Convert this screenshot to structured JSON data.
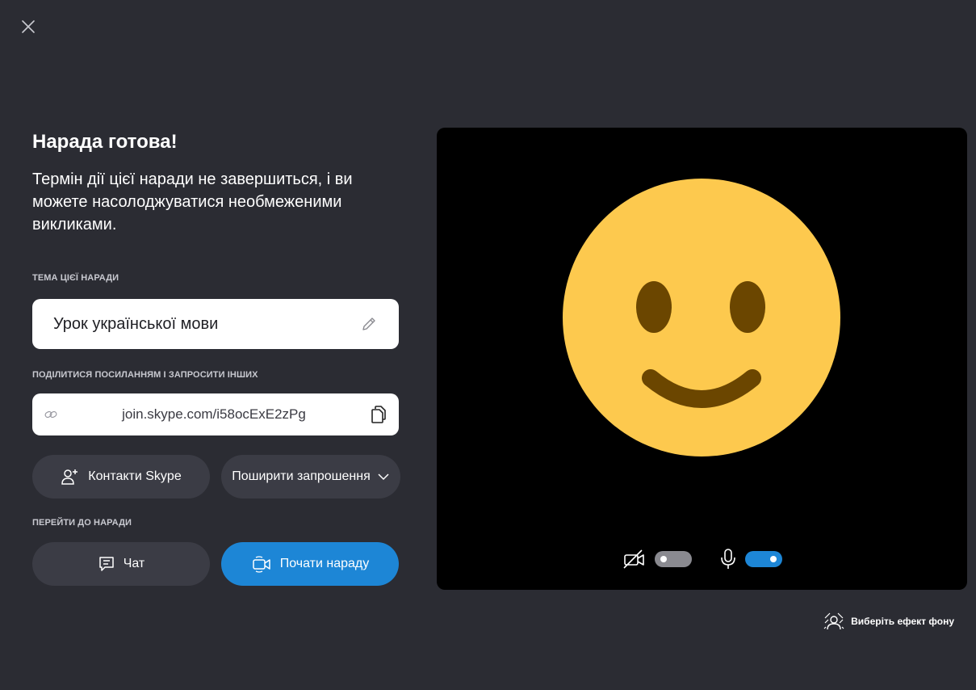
{
  "window": {
    "close_icon": "close-icon"
  },
  "meeting": {
    "title": "Нарада готова!",
    "description": "Термін дії цієї наради не завершиться, і ви можете насолоджуватися необмеженими викликами."
  },
  "topic": {
    "label": "ТЕМА ЦІЄЇ НАРАДИ",
    "value": "Урок української мови",
    "edit_icon": "pencil-icon"
  },
  "share": {
    "label": "ПОДІЛИТИСЯ ПОСИЛАННЯМ І ЗАПРОСИТИ ІНШИХ",
    "link": "join.skype.com/i58ocExE2zPg",
    "link_icon": "link-icon",
    "copy_icon": "copy-icon",
    "contacts_button": "Контакти Skype",
    "share_invite_button": "Поширити запрошення"
  },
  "go": {
    "label": "ПЕРЕЙТИ ДО НАРАДИ",
    "chat_button": "Чат",
    "start_button": "Почати нараду"
  },
  "preview": {
    "avatar": "smiley-face",
    "camera_enabled": false,
    "mic_enabled": true
  },
  "background_effect": {
    "label": "Виберіть ефект фону",
    "icon": "background-effect-icon"
  },
  "colors": {
    "background": "#2b2c33",
    "accent": "#1d86d6",
    "button_dark": "#3b3c45",
    "smiley": "#fdc94e",
    "smiley_features": "#6b4600"
  }
}
